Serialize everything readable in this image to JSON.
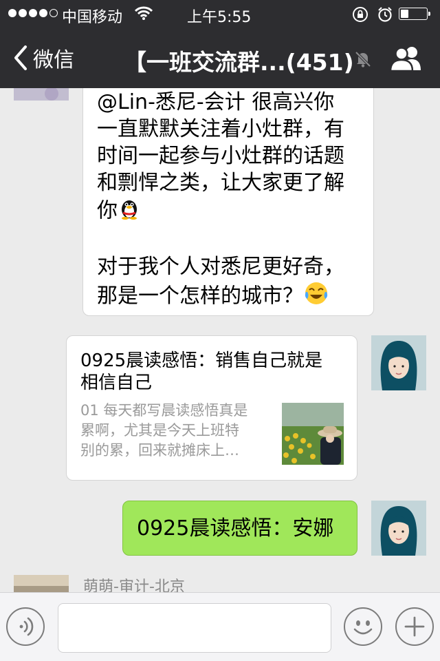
{
  "status_bar": {
    "carrier": "中国移动",
    "time": "上午5:55",
    "battery_level": 0.3
  },
  "navbar": {
    "back_label": "微信",
    "title": "【一班交流群...(451)"
  },
  "messages": {
    "m1": {
      "lines": [
        "@Lin-悉尼-会计 很高兴你",
        "一直默默关注着小灶群，有",
        "时间一起参与小灶群的话题",
        "和剽悍之类，让大家更了解",
        "你",
        "",
        "对于我个人对悉尼更好奇，",
        "那是一个怎样的城市？"
      ],
      "emoji_1": "penguin-emoji",
      "emoji_2": "tears-of-joy-emoji"
    },
    "m2": {
      "title_line1": "0925晨读感悟：销售自己就是",
      "title_line2": "相信自己",
      "desc_line1": "01 每天都写晨读感悟真是",
      "desc_line2": "累啊，尤其是今天上班特",
      "desc_line3": "别的累，回来就摊床上…"
    },
    "m3": {
      "text": "0925晨读感悟：安娜"
    },
    "next_sender": "萌萌-审计-北京"
  },
  "colors": {
    "bar_bg": "#2d2d30",
    "chat_bg": "#ebebeb",
    "green_bubble": "#a0e75a",
    "link_desc": "#9a9a9a"
  },
  "icons": {
    "back": "chevron-left-icon",
    "mute": "bell-mute-icon",
    "members": "group-icon",
    "voice": "voice-icon",
    "emoji": "smiley-icon",
    "plus": "plus-icon"
  }
}
